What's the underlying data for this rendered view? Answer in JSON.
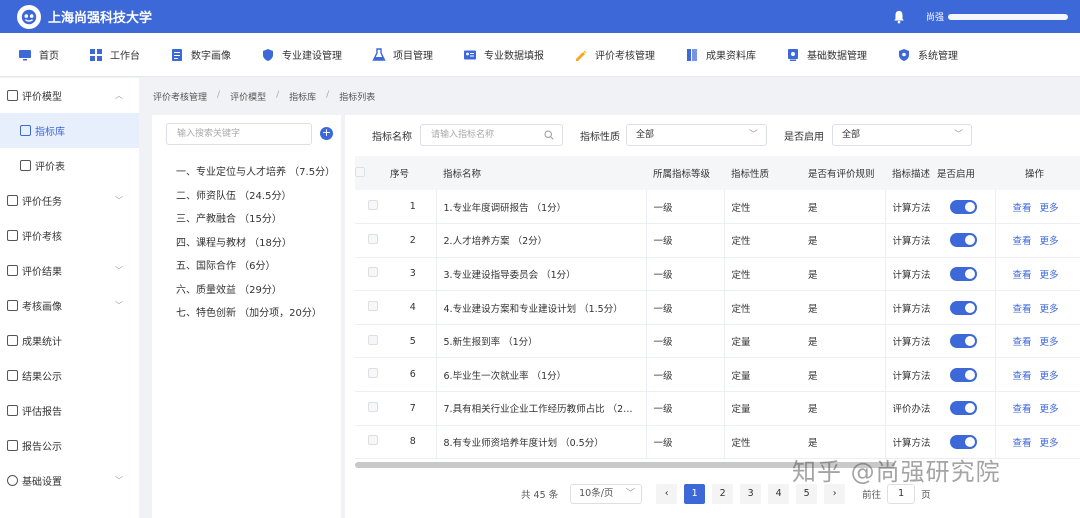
{
  "app": {
    "title": "上海尚强科技大学",
    "user_label": "尚强"
  },
  "colors": {
    "primary": "#3d68d8",
    "topbar": "#3d68d8"
  },
  "mainnav": [
    {
      "label": "首页",
      "icon": "monitor-icon"
    },
    {
      "label": "工作台",
      "icon": "grid-icon"
    },
    {
      "label": "数字画像",
      "icon": "document-icon"
    },
    {
      "label": "专业建设管理",
      "icon": "shield-icon"
    },
    {
      "label": "项目管理",
      "icon": "flask-icon"
    },
    {
      "label": "专业数据填报",
      "icon": "id-card-icon"
    },
    {
      "label": "评价考核管理",
      "icon": "pencil-icon"
    },
    {
      "label": "成果资料库",
      "icon": "book-icon"
    },
    {
      "label": "基础数据管理",
      "icon": "database-icon"
    },
    {
      "label": "系统管理",
      "icon": "shield-icon"
    }
  ],
  "sidebar": {
    "items": [
      {
        "label": "评价模型",
        "expanded": true
      },
      {
        "label": "指标库",
        "sub": true,
        "active": true
      },
      {
        "label": "评价表",
        "sub": true
      },
      {
        "label": "评价任务",
        "chevron": true
      },
      {
        "label": "评价考核"
      },
      {
        "label": "评价结果",
        "chevron": true
      },
      {
        "label": "考核画像",
        "chevron": true
      },
      {
        "label": "成果统计"
      },
      {
        "label": "结果公示"
      },
      {
        "label": "评估报告"
      },
      {
        "label": "报告公示"
      },
      {
        "label": "基础设置",
        "chevron": true
      }
    ]
  },
  "breadcrumb": [
    "评价考核管理",
    "评价模型",
    "指标库",
    "指标列表"
  ],
  "tree": {
    "search_placeholder": "输入搜索关键字",
    "add_label": "+",
    "nodes": [
      "一、专业定位与人才培养 （7.5分）",
      "二、师资队伍 （24.5分）",
      "三、产教融合 （15分）",
      "四、课程与教材 （18分）",
      "五、国际合作 （6分）",
      "六、质量效益 （29分）",
      "七、特色创新 （加分项，20分）"
    ]
  },
  "filters": {
    "name_label": "指标名称",
    "name_placeholder": "请输入指标名称",
    "nature_label": "指标性质",
    "nature_value": "全部",
    "enabled_label": "是否启用",
    "enabled_value": "全部"
  },
  "table": {
    "headers": [
      "序号",
      "指标名称",
      "所属指标等级",
      "指标性质",
      "是否有评价规则",
      "指标描述",
      "是否启用",
      "操作"
    ],
    "view_label": "查看",
    "more_label": "更多",
    "rows": [
      {
        "no": "1",
        "name": "1.专业年度调研报告 （1分）",
        "level": "一级",
        "nature": "定性",
        "rule": "是",
        "desc": "计算方法",
        "enabled": true
      },
      {
        "no": "2",
        "name": "2.人才培养方案 （2分）",
        "level": "一级",
        "nature": "定性",
        "rule": "是",
        "desc": "计算方法",
        "enabled": true
      },
      {
        "no": "3",
        "name": "3.专业建设指导委员会 （1分）",
        "level": "一级",
        "nature": "定性",
        "rule": "是",
        "desc": "计算方法",
        "enabled": true
      },
      {
        "no": "4",
        "name": "4.专业建设方案和专业建设计划 （1.5分）",
        "level": "一级",
        "nature": "定性",
        "rule": "是",
        "desc": "计算方法",
        "enabled": true
      },
      {
        "no": "5",
        "name": "5.新生报到率 （1分）",
        "level": "一级",
        "nature": "定量",
        "rule": "是",
        "desc": "计算方法",
        "enabled": true
      },
      {
        "no": "6",
        "name": "6.毕业生一次就业率 （1分）",
        "level": "一级",
        "nature": "定量",
        "rule": "是",
        "desc": "计算方法",
        "enabled": true
      },
      {
        "no": "7",
        "name": "7.具有相关行业企业工作经历教师占比 （2…",
        "level": "一级",
        "nature": "定量",
        "rule": "是",
        "desc": "评价办法",
        "enabled": true
      },
      {
        "no": "8",
        "name": "8.有专业师资培养年度计划 （0.5分）",
        "level": "一级",
        "nature": "定性",
        "rule": "是",
        "desc": "计算方法",
        "enabled": true
      }
    ]
  },
  "pager": {
    "total_text": "共 45 条",
    "page_size": "10条/页",
    "prev": "‹",
    "next": "›",
    "pages": [
      "1",
      "2",
      "3",
      "4",
      "5"
    ],
    "current": "1",
    "goto_label": "前往",
    "goto_value": "1",
    "page_suffix": "页"
  },
  "watermark": "知乎 @尚强研究院"
}
